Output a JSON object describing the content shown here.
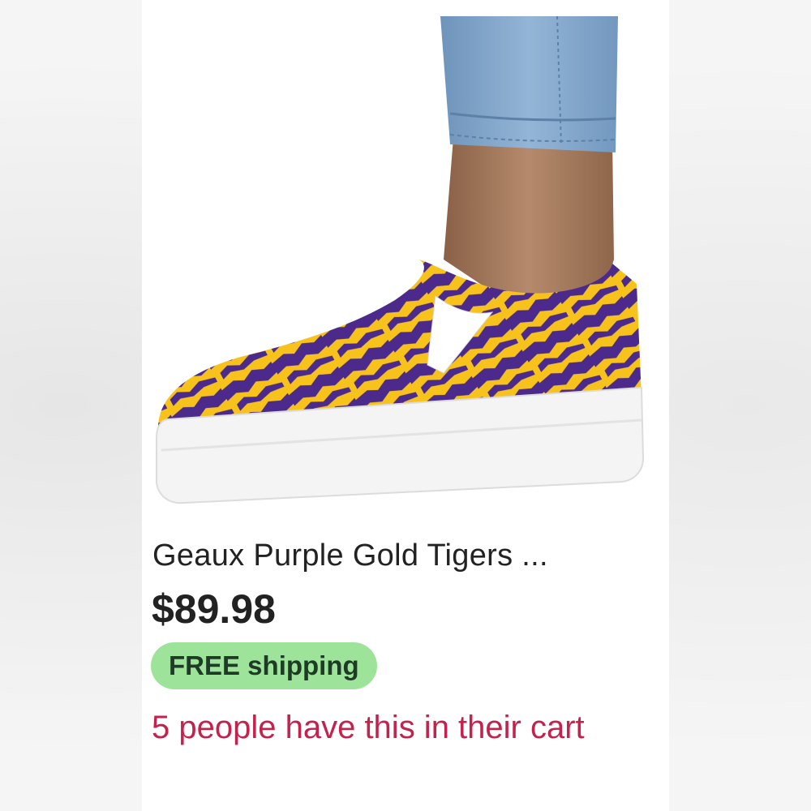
{
  "listing": {
    "title": "Geaux Purple Gold Tigers ...",
    "price": "$89.98",
    "shipping_badge": "FREE shipping",
    "demand_text": "5 people have this in their cart",
    "image": {
      "subject": "shoe-photo",
      "colors": {
        "pattern_purple": "#4b2a8c",
        "pattern_gold": "#f6c21b",
        "sole": "#f4f4f4",
        "denim": "#7ea3c8",
        "skin": "#a87c60"
      }
    }
  },
  "colors": {
    "badge_bg": "#9de39a",
    "demand_text": "#c4214c",
    "title_text": "#222222"
  }
}
